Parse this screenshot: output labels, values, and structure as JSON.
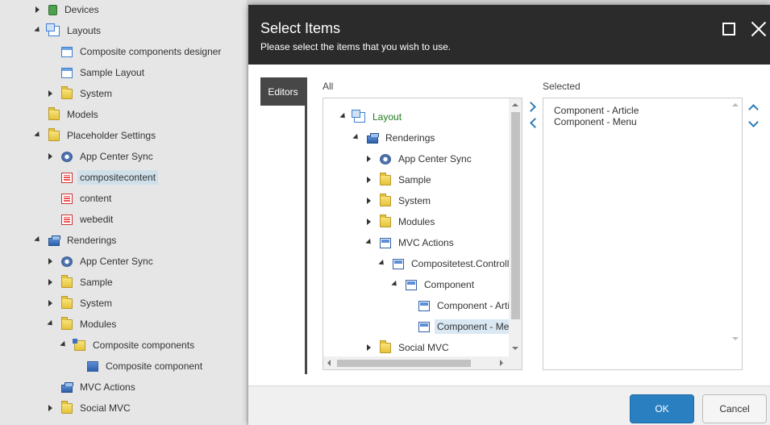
{
  "background_tree": {
    "items": [
      {
        "label": "Devices",
        "icon": "device-icon"
      },
      {
        "label": "Layouts",
        "icon": "layouts-icon"
      },
      {
        "label": "Composite components designer",
        "icon": "layout-icon"
      },
      {
        "label": "Sample Layout",
        "icon": "layout-icon"
      },
      {
        "label": "System",
        "icon": "folder-icon"
      },
      {
        "label": "Models",
        "icon": "folder-icon"
      },
      {
        "label": "Placeholder Settings",
        "icon": "folder-icon"
      },
      {
        "label": "App Center Sync",
        "icon": "gear-icon"
      },
      {
        "label": "compositecontent",
        "icon": "placeholder-icon"
      },
      {
        "label": "content",
        "icon": "placeholder-icon"
      },
      {
        "label": "webedit",
        "icon": "placeholder-icon"
      },
      {
        "label": "Renderings",
        "icon": "renderings-icon"
      },
      {
        "label": "App Center Sync",
        "icon": "gear-icon"
      },
      {
        "label": "Sample",
        "icon": "folder-icon"
      },
      {
        "label": "System",
        "icon": "folder-icon"
      },
      {
        "label": "Modules",
        "icon": "folder-icon"
      },
      {
        "label": "Composite components",
        "icon": "composite-folder-icon"
      },
      {
        "label": "Composite component",
        "icon": "composite-component-icon"
      },
      {
        "label": "MVC Actions",
        "icon": "renderings-icon"
      },
      {
        "label": "Social MVC",
        "icon": "folder-icon"
      }
    ]
  },
  "dialog": {
    "title": "Select Items",
    "subtitle": "Please select the items that you wish to use.",
    "tab_label": "Editors",
    "all_label": "All",
    "selected_label": "Selected",
    "all_tree": [
      {
        "label": "Layout",
        "icon": "layouts-icon"
      },
      {
        "label": "Renderings",
        "icon": "renderings-icon"
      },
      {
        "label": "App Center Sync",
        "icon": "gear-icon"
      },
      {
        "label": "Sample",
        "icon": "folder-icon"
      },
      {
        "label": "System",
        "icon": "folder-icon"
      },
      {
        "label": "Modules",
        "icon": "folder-icon"
      },
      {
        "label": "MVC Actions",
        "icon": "mvc-icon"
      },
      {
        "label": "Compositetest.Controll",
        "icon": "mvc-icon"
      },
      {
        "label": "Component",
        "icon": "mvc-icon"
      },
      {
        "label": "Component - Artic",
        "icon": "rendering-item-icon"
      },
      {
        "label": "Component - Me",
        "icon": "rendering-item-icon"
      },
      {
        "label": "Social MVC",
        "icon": "folder-icon"
      }
    ],
    "selected_items": [
      "Component - Article",
      "Component - Menu"
    ],
    "ok_label": "OK",
    "cancel_label": "Cancel"
  },
  "colors": {
    "header_bg": "#2b2b2b",
    "primary_button": "#2a7fc0",
    "accent_arrow": "#2a7ab8",
    "layout_label_green": "#1e7b1e"
  }
}
